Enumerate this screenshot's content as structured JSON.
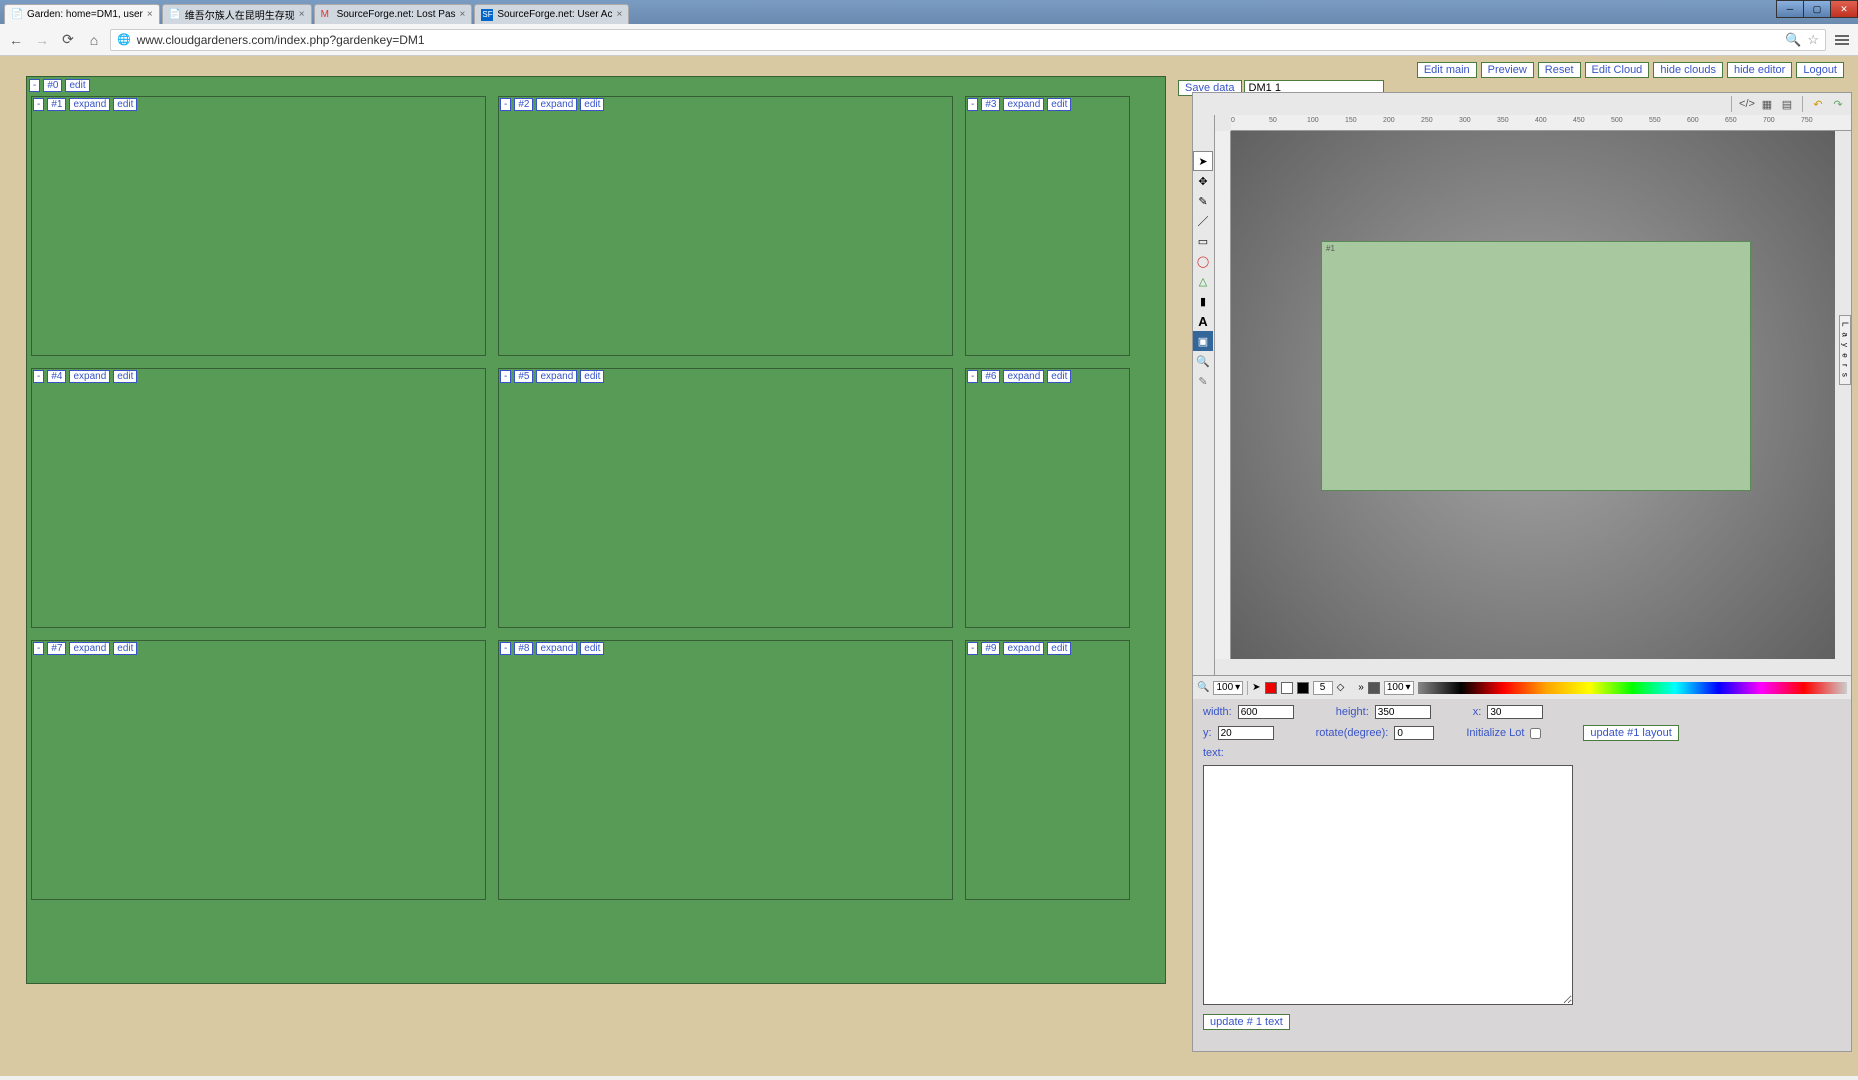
{
  "tabs": [
    {
      "title": "Garden: home=DM1, user",
      "fav": "page"
    },
    {
      "title": "维吾尔族人在昆明生存现",
      "fav": "page"
    },
    {
      "title": "SourceForge.net: Lost Pas",
      "fav": "gmail"
    },
    {
      "title": "SourceForge.net: User Ac",
      "fav": "sf"
    }
  ],
  "url": "www.cloudgardeners.com/index.php?gardenkey=DM1",
  "top_buttons": [
    "Edit main",
    "Preview",
    "Reset",
    "Edit Cloud",
    "hide clouds",
    "hide editor",
    "Logout"
  ],
  "save_row": {
    "save": "Save data",
    "input": "DM1 1"
  },
  "garden": {
    "top": {
      "collapse": "-",
      "id": "#0",
      "edit": "edit"
    },
    "btn_collapse": "-",
    "btn_expand": "expand",
    "btn_edit": "edit",
    "lots": [
      "#1",
      "#2",
      "#3",
      "#4",
      "#5",
      "#6",
      "#7",
      "#8",
      "#9"
    ]
  },
  "ruler_ticks": [
    "0",
    "50",
    "100",
    "150",
    "200",
    "250",
    "300",
    "350",
    "400",
    "450",
    "500",
    "550",
    "600",
    "650",
    "700",
    "750"
  ],
  "canvas_label": "#1",
  "layers": "L a y e r s",
  "zoom": "100",
  "stroke_w": "5",
  "opacity": "100",
  "form": {
    "width_l": "width:",
    "width_v": "600",
    "height_l": "height:",
    "height_v": "350",
    "x_l": "x:",
    "x_v": "30",
    "y_l": "y:",
    "y_v": "20",
    "rotate_l": "rotate(degree):",
    "rotate_v": "0",
    "init_l": "Initialize Lot",
    "update_layout": "update #1 layout",
    "text_l": "text:",
    "text_v": "",
    "update_text": "update # 1 text"
  }
}
